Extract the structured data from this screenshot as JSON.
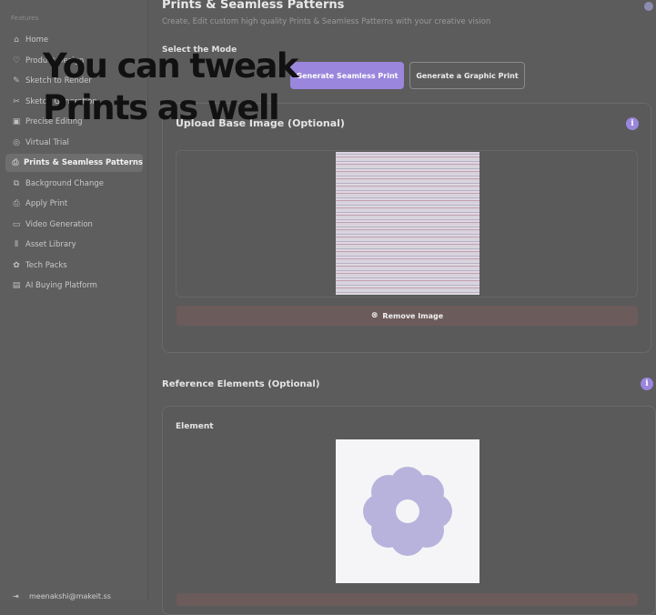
{
  "sidebar": {
    "heading": "Features",
    "items": [
      {
        "label": "Home",
        "icon": "⌂"
      },
      {
        "label": "Product Design",
        "icon": "♡"
      },
      {
        "label": "Sketch to Render",
        "icon": "✎"
      },
      {
        "label": "Sketch Generation",
        "icon": "✂"
      },
      {
        "label": "Precise Editing",
        "icon": "▣"
      },
      {
        "label": "Virtual Trial",
        "icon": "◎"
      },
      {
        "label": "Prints & Seamless Patterns",
        "icon": "⎙",
        "active": true
      },
      {
        "label": "Background Change",
        "icon": "⧉"
      },
      {
        "label": "Apply Print",
        "icon": "⎙"
      },
      {
        "label": "Video Generation",
        "icon": "▭"
      },
      {
        "label": "Asset Library",
        "icon": "⫴"
      },
      {
        "label": "Tech Packs",
        "icon": "✿"
      },
      {
        "label": "AI Buying Platform",
        "icon": "▤"
      }
    ],
    "user_email": "meenakshi@makeit.ss",
    "user_icon": "⇥"
  },
  "main": {
    "title": "Prints & Seamless Patterns",
    "subtitle": "Create, Edit custom high quality Prints & Seamless Patterns with your creative vision",
    "mode_label": "Select the Mode",
    "mode_buttons": {
      "seamless": "Generate Seamless Print",
      "graphic": "Generate a Graphic Print"
    },
    "upload": {
      "title": "Upload Base Image (Optional)",
      "info_icon": "i",
      "remove_label": "Remove Image",
      "remove_icon": "⊗"
    },
    "reference": {
      "title": "Reference Elements (Optional)",
      "info_icon": "i",
      "element_label": "Element"
    }
  },
  "overlay": {
    "line1": "You can tweak",
    "line2": "Prints as well"
  },
  "colors": {
    "accent": "#9a86dc",
    "flower": "#b7b3dc",
    "remove": "#6c5b5b"
  }
}
